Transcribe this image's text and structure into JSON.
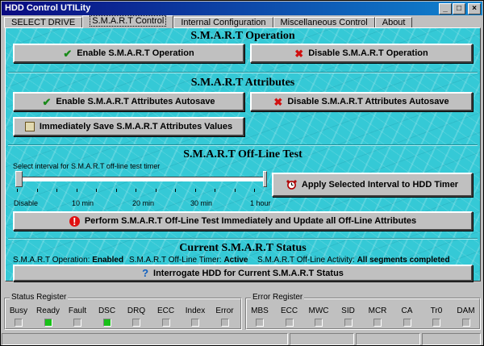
{
  "window": {
    "title": "HDD Control UTILity",
    "controls": {
      "minimize": "_",
      "maximize": "□",
      "close": "×"
    }
  },
  "tabs": [
    {
      "label": "SELECT DRIVE"
    },
    {
      "label": "S.M.A.R.T Control",
      "active": true
    },
    {
      "label": "Internal Configuration"
    },
    {
      "label": "Miscellaneous Control"
    },
    {
      "label": "About"
    }
  ],
  "smart_operation": {
    "title": "S.M.A.R.T Operation",
    "enable_label": "Enable S.M.A.R.T Operation",
    "disable_label": "Disable S.M.A.R.T Operation"
  },
  "smart_attributes": {
    "title": "S.M.A.R.T Attributes",
    "enable_autosave_label": "Enable S.M.A.R.T Attributes Autosave",
    "disable_autosave_label": "Disable S.M.A.R.T Attributes Autosave",
    "save_now_label": "Immediately Save S.M.A.R.T Attributes Values"
  },
  "offline_test": {
    "title": "S.M.A.R.T Off-Line Test",
    "slider_caption": "Select interval for S.M.A.R.T off-line test timer",
    "slider_value_fraction": 0,
    "tick_labels": [
      "Disable",
      "10 min",
      "20 min",
      "30 min",
      "1 hour"
    ],
    "apply_label": "Apply Selected Interval to HDD Timer",
    "perform_label": "Perform S.M.A.R.T Off-Line Test Immediately and Update all Off-Line Attributes"
  },
  "current_status": {
    "title": "Current S.M.A.R.T Status",
    "operation_label": "S.M.A.R.T Operation:",
    "operation_value": "Enabled",
    "timer_label": "S.M.A.R.T Off-Line Timer:",
    "timer_value": "Active",
    "activity_label": "S.M.A.R.T Off-Line Activity:",
    "activity_value": "All segments completed",
    "interrogate_label": "Interrogate HDD for Current S.M.A.R.T Status"
  },
  "status_register": {
    "title": "Status Register",
    "bits": [
      {
        "label": "Busy",
        "on": false
      },
      {
        "label": "Ready",
        "on": true
      },
      {
        "label": "Fault",
        "on": false
      },
      {
        "label": "DSC",
        "on": true
      },
      {
        "label": "DRQ",
        "on": false
      },
      {
        "label": "ECC",
        "on": false
      },
      {
        "label": "Index",
        "on": false
      },
      {
        "label": "Error",
        "on": false
      }
    ]
  },
  "error_register": {
    "title": "Error Register",
    "bits": [
      {
        "label": "MBS",
        "on": false
      },
      {
        "label": "ECC",
        "on": false
      },
      {
        "label": "MWC",
        "on": false
      },
      {
        "label": "SID",
        "on": false
      },
      {
        "label": "MCR",
        "on": false
      },
      {
        "label": "CA",
        "on": false
      },
      {
        "label": "Tr0",
        "on": false
      },
      {
        "label": "DAM",
        "on": false
      }
    ]
  },
  "colors": {
    "panel_bg": "#35c9d6",
    "titlebar": "#0a0a80",
    "led_on": "#18c018",
    "check_icon": "#1a8a1a",
    "x_icon": "#d01010"
  }
}
